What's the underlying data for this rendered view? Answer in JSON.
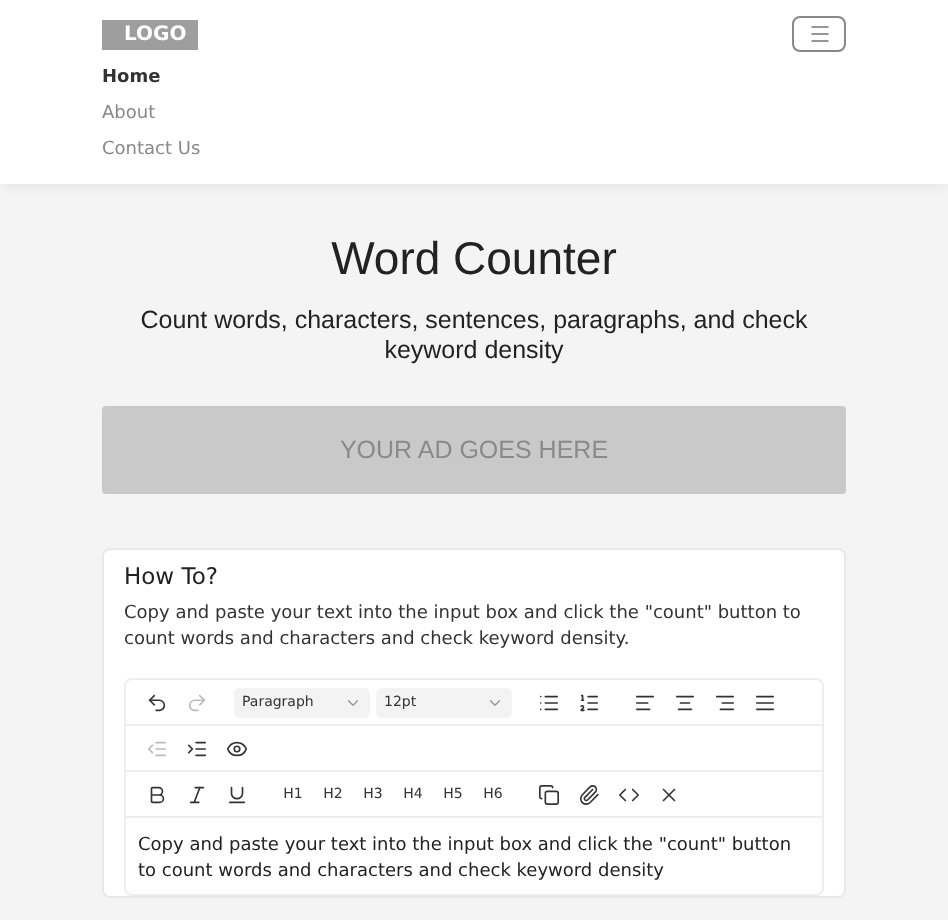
{
  "header": {
    "logo": "LOGO",
    "nav": [
      {
        "label": "Home",
        "selected": true
      },
      {
        "label": "About",
        "selected": false
      },
      {
        "label": "Contact Us",
        "selected": false
      }
    ]
  },
  "hero": {
    "title": "Word Counter",
    "subtitle": "Count words, characters, sentences, paragraphs, and check keyword density"
  },
  "ad": {
    "text": "YOUR AD GOES HERE"
  },
  "howto": {
    "title": "How To?",
    "text": "Copy and paste your text into the input box and click the \"count\" button to count words and characters and check keyword density."
  },
  "editor": {
    "toolbar": [
      [
        {
          "kind": "icon",
          "disabled": false
        },
        {
          "kind": "icon",
          "disabled": true
        },
        {
          "kind": "select",
          "value": "Paragraph"
        },
        {
          "kind": "select",
          "value": "12pt"
        },
        {
          "kind": "icon",
          "disabled": false
        },
        {
          "kind": "icon",
          "disabled": false
        },
        {
          "kind": "icon",
          "disabled": false
        },
        {
          "kind": "icon",
          "disabled": false
        },
        {
          "kind": "icon",
          "disabled": false
        },
        {
          "kind": "icon",
          "disabled": false
        }
      ],
      [
        {
          "kind": "icon",
          "disabled": true
        },
        {
          "kind": "icon",
          "disabled": false
        },
        {
          "kind": "icon",
          "disabled": false
        }
      ],
      [
        {
          "kind": "icon",
          "disabled": false
        },
        {
          "kind": "icon",
          "disabled": false
        },
        {
          "kind": "icon",
          "disabled": false
        },
        {
          "kind": "text",
          "label": "H1"
        },
        {
          "kind": "text",
          "label": "H2"
        },
        {
          "kind": "text",
          "label": "H3"
        },
        {
          "kind": "text",
          "label": "H4"
        },
        {
          "kind": "text",
          "label": "H5"
        },
        {
          "kind": "text",
          "label": "H6"
        },
        {
          "kind": "icon",
          "disabled": false
        },
        {
          "kind": "icon",
          "disabled": false
        },
        {
          "kind": "icon",
          "disabled": false
        },
        {
          "kind": "icon",
          "disabled": false
        }
      ]
    ],
    "content": "Copy and paste your text into the input box and click the \"count\" button to count words and characters and check keyword density"
  }
}
